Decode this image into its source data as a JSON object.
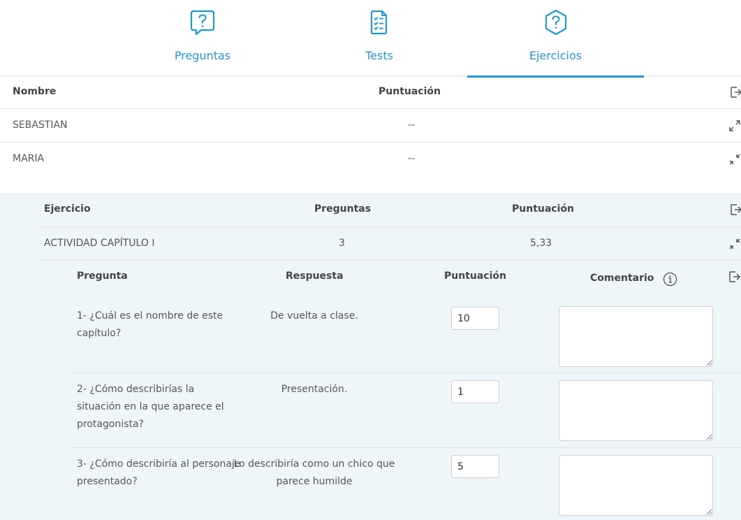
{
  "tabs": [
    {
      "label": "Preguntas",
      "icon": "question-bubble-icon",
      "active": false
    },
    {
      "label": "Tests",
      "icon": "checklist-icon",
      "active": false
    },
    {
      "label": "Ejercicios",
      "icon": "question-hexagon-icon",
      "active": true
    }
  ],
  "students_table": {
    "headers": {
      "name": "Nombre",
      "score": "Puntuación"
    },
    "rows": [
      {
        "name": "SEBASTIAN",
        "score": "--",
        "toggle_icon": "expand-icon"
      },
      {
        "name": "MARIA",
        "score": "--",
        "toggle_icon": "collapse-icon"
      }
    ]
  },
  "exercises_table": {
    "headers": {
      "exercise": "Ejercicio",
      "questions": "Preguntas",
      "score": "Puntuación"
    },
    "rows": [
      {
        "exercise": "ACTIVIDAD CAPÍTULO I",
        "questions": "3",
        "score": "5,33",
        "toggle_icon": "collapse-icon"
      }
    ]
  },
  "questions_table": {
    "headers": {
      "question": "Pregunta",
      "answer": "Respuesta",
      "score": "Puntuación",
      "comment": "Comentario"
    },
    "rows": [
      {
        "question": "1- ¿Cuál es el nombre de este capítulo?",
        "answer": "De vuelta a clase.",
        "score": "10",
        "comment": ""
      },
      {
        "question": "2- ¿Cómo describirías la situación en la que aparece el protagonista?",
        "answer": "Presentación.",
        "score": "1",
        "comment": ""
      },
      {
        "question": "3- ¿Cómo describiría al personaje presentado?",
        "answer": "Lo describiría como un chico que parece humilde",
        "score": "5",
        "comment": ""
      }
    ]
  },
  "colors": {
    "accent": "#1e9ad6",
    "panel_bg": "#eef6fa",
    "border": "#e4e4e4"
  }
}
